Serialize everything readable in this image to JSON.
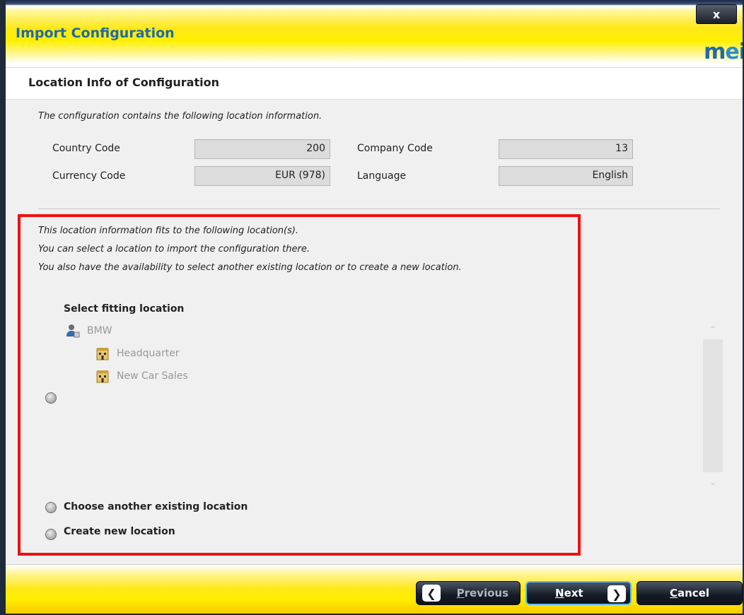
{
  "window": {
    "title": "Import Configuration",
    "close_label": "x",
    "logo_text_m": "m",
    "logo_text_e": "e",
    "logo_text_i": "i"
  },
  "section": {
    "title": "Location Info of Configuration"
  },
  "config_info": {
    "intro": "The configuration contains the following location information.",
    "fields": [
      {
        "label": "Country Code",
        "value": "200"
      },
      {
        "label": "Company Code",
        "value": "13"
      },
      {
        "label": "Currency Code",
        "value": "EUR (978)"
      },
      {
        "label": "Language",
        "value": "English"
      }
    ]
  },
  "location": {
    "info_lines": [
      "This location information fits to the following location(s).",
      "You can select a location to import the configuration there.",
      "You also have the availability to select another existing location or to create a new location."
    ],
    "tree_title": "Select fitting location",
    "tree": {
      "company": {
        "label": "BMW",
        "icon": "company-user-icon"
      },
      "children": [
        {
          "label": "Headquarter",
          "icon": "building-icon"
        },
        {
          "label": "New Car Sales",
          "icon": "building-icon"
        }
      ]
    },
    "options": [
      {
        "label": "Choose another existing location"
      },
      {
        "label": "Create new location"
      }
    ]
  },
  "footer": {
    "previous_label": "Previous",
    "next_label": "Next",
    "cancel_label": "Cancel"
  },
  "colors": {
    "title_blue": "#1e6aa8",
    "highlight_red": "#ee1111",
    "footer_yellow": "#ffe817",
    "next_border": "#5cbcf0"
  }
}
